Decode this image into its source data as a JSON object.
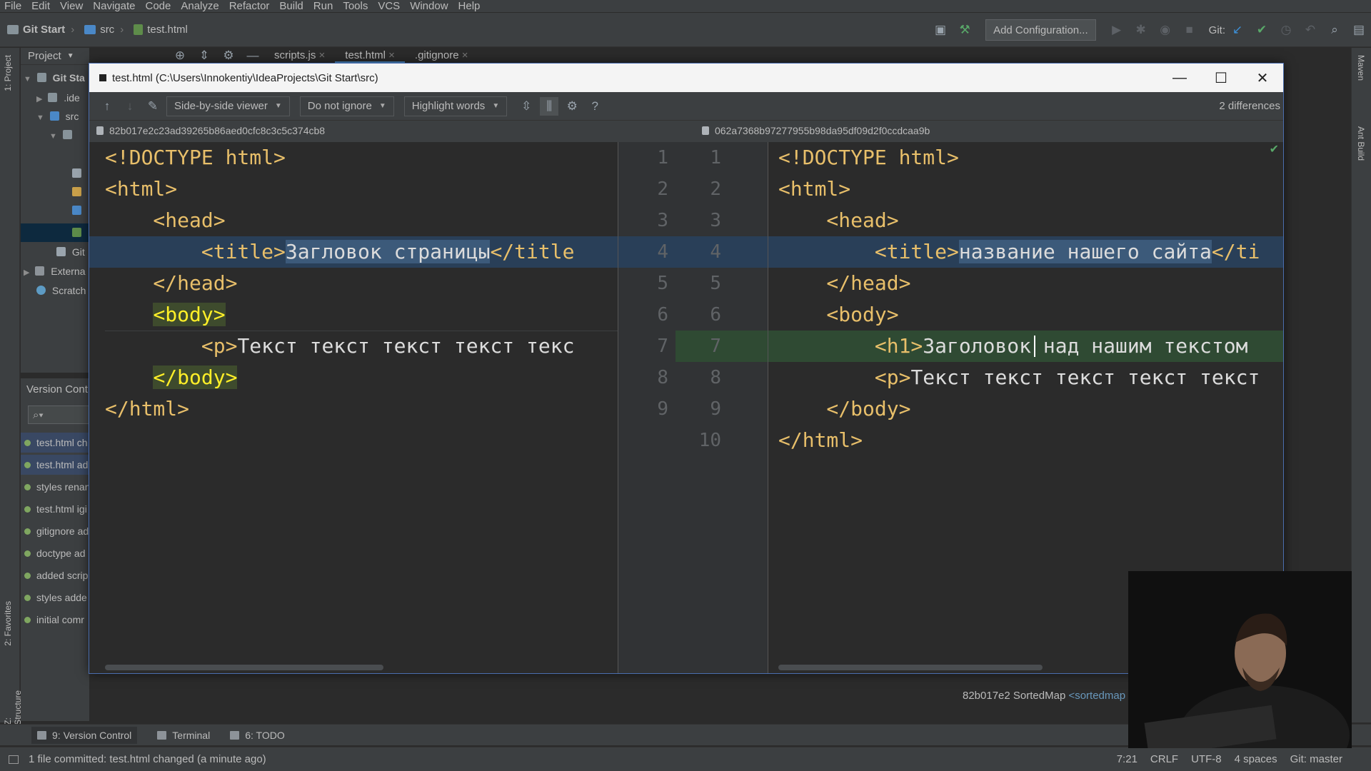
{
  "menu": [
    "File",
    "Edit",
    "View",
    "Navigate",
    "Code",
    "Analyze",
    "Refactor",
    "Build",
    "Run",
    "Tools",
    "VCS",
    "Window",
    "Help"
  ],
  "breadcrumb": [
    "Git Start",
    "src",
    "test.html"
  ],
  "toolbar": {
    "add_config": "Add Configuration...",
    "git_label": "Git:"
  },
  "project": {
    "header": "Project",
    "rows": [
      "Git Sta",
      ".ide",
      "src",
      "Git",
      "Externa",
      "Scratch"
    ]
  },
  "editor_tabs": [
    "scripts.js",
    "test.html",
    ".gitignore"
  ],
  "side_tabs": {
    "project": "1: Project",
    "favorites": "2: Favorites",
    "structure": "Z: Structure",
    "maven": "Maven",
    "ant": "Ant Build"
  },
  "version_control": {
    "header": "Version Cont",
    "commits": [
      "test.html ch",
      "test.html ad",
      "styles renan",
      "test.html igi",
      "gitignore ad",
      "doctype ad",
      "added scrip",
      "styles adde",
      "initial comr"
    ]
  },
  "dialog": {
    "title": "test.html (C:\\Users\\Innokentiy\\IdeaProjects\\Git Start\\src)",
    "viewer": "Side-by-side viewer",
    "ignore": "Do not ignore",
    "highlight": "Highlight words",
    "diff_count": "2 differences",
    "left_hash": "82b017e2c23ad39265b86aed0cfc8c3c5c374cb8",
    "right_hash": "062a7368b97277955b98da95df09d2f0ccdcaa9b",
    "left_lines": [
      {
        "num": "1",
        "pre": "<!DOCTYPE html>",
        "hl": "",
        "post": ""
      },
      {
        "num": "2",
        "pre": "<html>",
        "hl": "",
        "post": ""
      },
      {
        "num": "3",
        "pre": "    <head>",
        "hl": "",
        "post": ""
      },
      {
        "num": "4",
        "pre": "        <title>",
        "hl": "Загловок страницы",
        "post": "</title"
      },
      {
        "num": "5",
        "pre": "    </head>",
        "hl": "",
        "post": ""
      },
      {
        "num": "6",
        "pre": "    ",
        "hl": "",
        "post": ""
      },
      {
        "num": "7",
        "pre": "        <p>",
        "hl": "",
        "post": "Текст текст текст текст текс"
      },
      {
        "num": "8",
        "pre": "    ",
        "hl": "",
        "post": ""
      },
      {
        "num": "9",
        "pre": "</html>",
        "hl": "",
        "post": ""
      }
    ],
    "left_body_open": "<body>",
    "left_body_close": "</body>",
    "right_lines": [
      {
        "num": "1",
        "pre": "<!DOCTYPE html>",
        "hl": "",
        "post": ""
      },
      {
        "num": "2",
        "pre": "<html>",
        "hl": "",
        "post": ""
      },
      {
        "num": "3",
        "pre": "    <head>",
        "hl": "",
        "post": ""
      },
      {
        "num": "4",
        "pre": "        <title>",
        "hl": "название нашего сайта",
        "post": "</ti"
      },
      {
        "num": "5",
        "pre": "    </head>",
        "hl": "",
        "post": ""
      },
      {
        "num": "6",
        "pre": "    <body>",
        "hl": "",
        "post": ""
      },
      {
        "num": "7",
        "pre": "        <h1>",
        "hl": "",
        "post": "Заголовок над нашим текстом"
      },
      {
        "num": "8",
        "pre": "        <p>",
        "hl": "",
        "post": "Текст текст текст текст текст"
      },
      {
        "num": "9",
        "pre": "    </body>",
        "hl": "",
        "post": ""
      },
      {
        "num": "10",
        "pre": "</html>",
        "hl": "",
        "post": ""
      }
    ]
  },
  "footer_commit": {
    "text": "82b017e2 SortedMap",
    "link": "<sortedmap"
  },
  "bottom_tabs": [
    "9: Version Control",
    "Terminal",
    "6: TODO"
  ],
  "status": {
    "message": "1 file committed: test.html changed (a minute ago)",
    "position": "7:21",
    "line_sep": "CRLF",
    "encoding": "UTF-8",
    "indent": "4 spaces",
    "branch": "Git: master"
  },
  "colors": {
    "accent": "#4a88c7",
    "modified": "#293f58",
    "inserted": "#2f4a33",
    "tag": "#e8bf6a"
  }
}
